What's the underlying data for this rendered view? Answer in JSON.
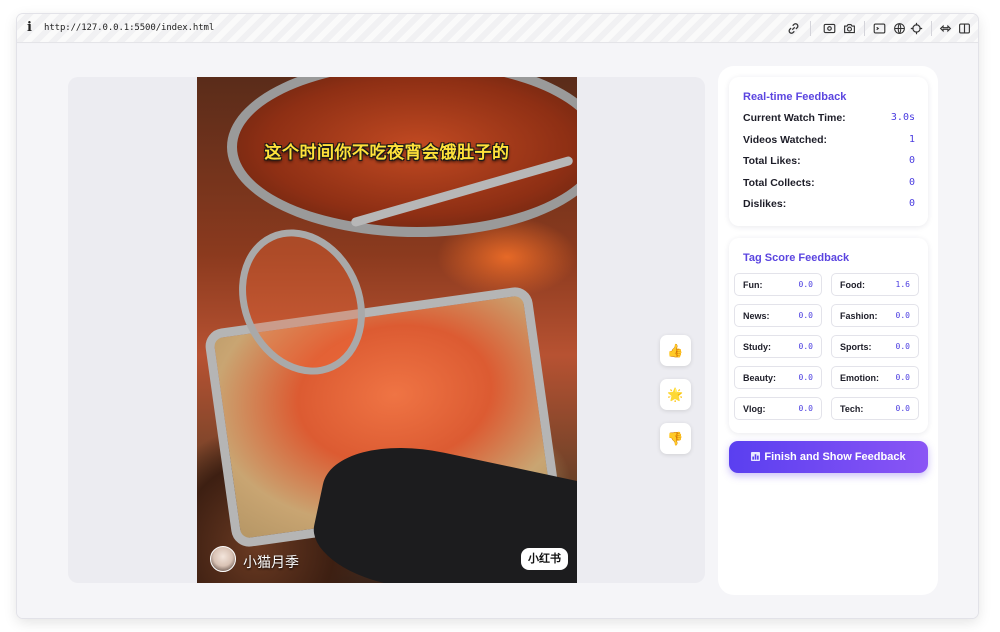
{
  "browser": {
    "url": "http://127.0.0.1:5500/index.html",
    "info_glyph": "i",
    "toolbar_icons": [
      "link-icon",
      "screenshot-icon",
      "camera-icon",
      "terminal-icon",
      "globe-icon",
      "crosshair-icon",
      "extension-icon",
      "sidebar-icon"
    ]
  },
  "video": {
    "caption": "这个时间你不吃夜宵会饿肚子的",
    "author": "小猫月季",
    "watermark": "小红书",
    "actions": [
      {
        "name": "like-button",
        "icon": "thumbs-up-icon",
        "glyph": "👍"
      },
      {
        "name": "collect-button",
        "icon": "star-icon",
        "glyph": "🌟"
      },
      {
        "name": "dislike-button",
        "icon": "thumbs-down-icon",
        "glyph": "👎"
      }
    ]
  },
  "feedback": {
    "title": "Real-time Feedback",
    "stats": [
      {
        "label": "Current Watch Time:",
        "value": "3.0s"
      },
      {
        "label": "Videos Watched:",
        "value": "1"
      },
      {
        "label": "Total Likes:",
        "value": "0"
      },
      {
        "label": "Total Collects:",
        "value": "0"
      },
      {
        "label": "Dislikes:",
        "value": "0"
      }
    ]
  },
  "tags": {
    "title": "Tag Score Feedback",
    "items": [
      {
        "label": "Fun:",
        "value": "0.0"
      },
      {
        "label": "Food:",
        "value": "1.6"
      },
      {
        "label": "News:",
        "value": "0.0"
      },
      {
        "label": "Fashion:",
        "value": "0.0"
      },
      {
        "label": "Study:",
        "value": "0.0"
      },
      {
        "label": "Sports:",
        "value": "0.0"
      },
      {
        "label": "Beauty:",
        "value": "0.0"
      },
      {
        "label": "Emotion:",
        "value": "0.0"
      },
      {
        "label": "Vlog:",
        "value": "0.0"
      },
      {
        "label": "Tech:",
        "value": "0.0"
      }
    ]
  },
  "finish_button": {
    "label": "Finish and Show Feedback",
    "icon": "bar-chart-icon"
  },
  "colors": {
    "accent": "#5b45e0",
    "value": "#4a3ce0",
    "button_start": "#5a3ff0",
    "button_end": "#8a55f5",
    "caption": "#ffe23a"
  }
}
